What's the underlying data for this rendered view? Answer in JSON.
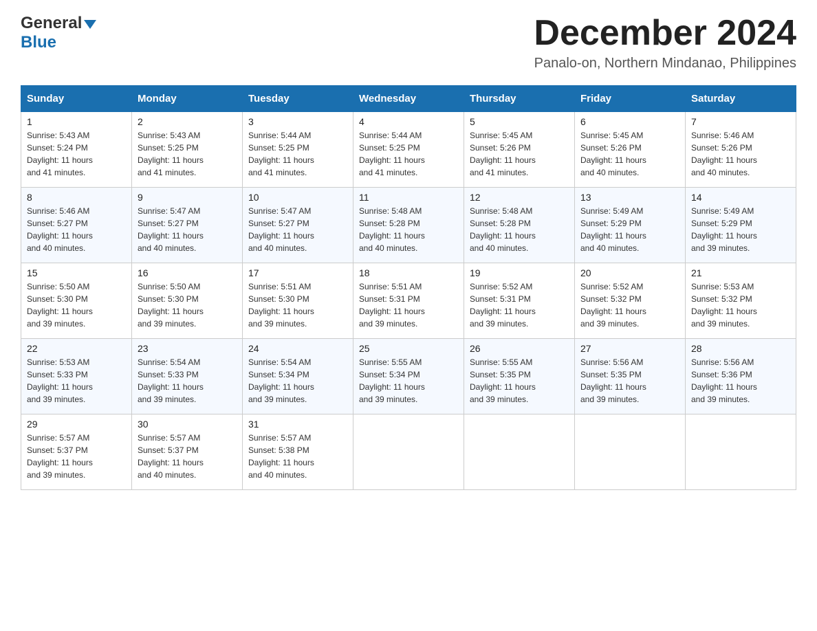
{
  "header": {
    "logo_general": "General",
    "logo_blue": "Blue",
    "month_title": "December 2024",
    "location": "Panalo-on, Northern Mindanao, Philippines"
  },
  "days_of_week": [
    "Sunday",
    "Monday",
    "Tuesday",
    "Wednesday",
    "Thursday",
    "Friday",
    "Saturday"
  ],
  "weeks": [
    [
      {
        "day": "1",
        "sunrise": "5:43 AM",
        "sunset": "5:24 PM",
        "daylight": "11 hours and 41 minutes."
      },
      {
        "day": "2",
        "sunrise": "5:43 AM",
        "sunset": "5:25 PM",
        "daylight": "11 hours and 41 minutes."
      },
      {
        "day": "3",
        "sunrise": "5:44 AM",
        "sunset": "5:25 PM",
        "daylight": "11 hours and 41 minutes."
      },
      {
        "day": "4",
        "sunrise": "5:44 AM",
        "sunset": "5:25 PM",
        "daylight": "11 hours and 41 minutes."
      },
      {
        "day": "5",
        "sunrise": "5:45 AM",
        "sunset": "5:26 PM",
        "daylight": "11 hours and 41 minutes."
      },
      {
        "day": "6",
        "sunrise": "5:45 AM",
        "sunset": "5:26 PM",
        "daylight": "11 hours and 40 minutes."
      },
      {
        "day": "7",
        "sunrise": "5:46 AM",
        "sunset": "5:26 PM",
        "daylight": "11 hours and 40 minutes."
      }
    ],
    [
      {
        "day": "8",
        "sunrise": "5:46 AM",
        "sunset": "5:27 PM",
        "daylight": "11 hours and 40 minutes."
      },
      {
        "day": "9",
        "sunrise": "5:47 AM",
        "sunset": "5:27 PM",
        "daylight": "11 hours and 40 minutes."
      },
      {
        "day": "10",
        "sunrise": "5:47 AM",
        "sunset": "5:27 PM",
        "daylight": "11 hours and 40 minutes."
      },
      {
        "day": "11",
        "sunrise": "5:48 AM",
        "sunset": "5:28 PM",
        "daylight": "11 hours and 40 minutes."
      },
      {
        "day": "12",
        "sunrise": "5:48 AM",
        "sunset": "5:28 PM",
        "daylight": "11 hours and 40 minutes."
      },
      {
        "day": "13",
        "sunrise": "5:49 AM",
        "sunset": "5:29 PM",
        "daylight": "11 hours and 40 minutes."
      },
      {
        "day": "14",
        "sunrise": "5:49 AM",
        "sunset": "5:29 PM",
        "daylight": "11 hours and 39 minutes."
      }
    ],
    [
      {
        "day": "15",
        "sunrise": "5:50 AM",
        "sunset": "5:30 PM",
        "daylight": "11 hours and 39 minutes."
      },
      {
        "day": "16",
        "sunrise": "5:50 AM",
        "sunset": "5:30 PM",
        "daylight": "11 hours and 39 minutes."
      },
      {
        "day": "17",
        "sunrise": "5:51 AM",
        "sunset": "5:30 PM",
        "daylight": "11 hours and 39 minutes."
      },
      {
        "day": "18",
        "sunrise": "5:51 AM",
        "sunset": "5:31 PM",
        "daylight": "11 hours and 39 minutes."
      },
      {
        "day": "19",
        "sunrise": "5:52 AM",
        "sunset": "5:31 PM",
        "daylight": "11 hours and 39 minutes."
      },
      {
        "day": "20",
        "sunrise": "5:52 AM",
        "sunset": "5:32 PM",
        "daylight": "11 hours and 39 minutes."
      },
      {
        "day": "21",
        "sunrise": "5:53 AM",
        "sunset": "5:32 PM",
        "daylight": "11 hours and 39 minutes."
      }
    ],
    [
      {
        "day": "22",
        "sunrise": "5:53 AM",
        "sunset": "5:33 PM",
        "daylight": "11 hours and 39 minutes."
      },
      {
        "day": "23",
        "sunrise": "5:54 AM",
        "sunset": "5:33 PM",
        "daylight": "11 hours and 39 minutes."
      },
      {
        "day": "24",
        "sunrise": "5:54 AM",
        "sunset": "5:34 PM",
        "daylight": "11 hours and 39 minutes."
      },
      {
        "day": "25",
        "sunrise": "5:55 AM",
        "sunset": "5:34 PM",
        "daylight": "11 hours and 39 minutes."
      },
      {
        "day": "26",
        "sunrise": "5:55 AM",
        "sunset": "5:35 PM",
        "daylight": "11 hours and 39 minutes."
      },
      {
        "day": "27",
        "sunrise": "5:56 AM",
        "sunset": "5:35 PM",
        "daylight": "11 hours and 39 minutes."
      },
      {
        "day": "28",
        "sunrise": "5:56 AM",
        "sunset": "5:36 PM",
        "daylight": "11 hours and 39 minutes."
      }
    ],
    [
      {
        "day": "29",
        "sunrise": "5:57 AM",
        "sunset": "5:37 PM",
        "daylight": "11 hours and 39 minutes."
      },
      {
        "day": "30",
        "sunrise": "5:57 AM",
        "sunset": "5:37 PM",
        "daylight": "11 hours and 40 minutes."
      },
      {
        "day": "31",
        "sunrise": "5:57 AM",
        "sunset": "5:38 PM",
        "daylight": "11 hours and 40 minutes."
      },
      null,
      null,
      null,
      null
    ]
  ],
  "labels": {
    "sunrise": "Sunrise:",
    "sunset": "Sunset:",
    "daylight": "Daylight:"
  }
}
